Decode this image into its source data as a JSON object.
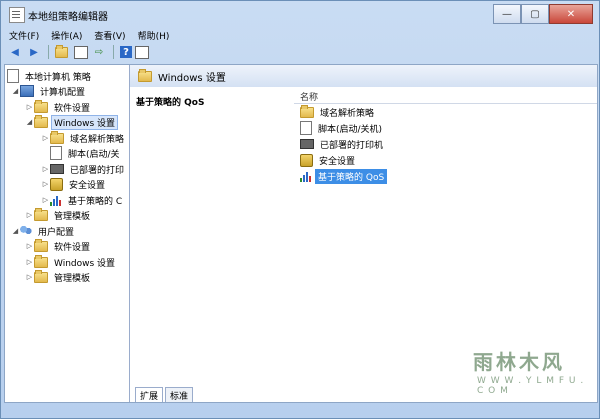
{
  "window": {
    "title": "本地组策略编辑器",
    "minimize": "—",
    "maximize": "▢",
    "close": "✕"
  },
  "menu": [
    "文件(F)",
    "操作(A)",
    "查看(V)",
    "帮助(H)"
  ],
  "tree": [
    {
      "label": "本地计算机 策略",
      "icon": "policy-icon",
      "level": 0,
      "arrow": ""
    },
    {
      "label": "计算机配置",
      "icon": "computer-icon",
      "level": 1,
      "arrow": "◢"
    },
    {
      "label": "软件设置",
      "icon": "folder-icon",
      "level": 2,
      "arrow": "▷"
    },
    {
      "label": "Windows 设置",
      "icon": "folder-icon",
      "level": 2,
      "arrow": "◢",
      "selected": true
    },
    {
      "label": "域名解析策略",
      "icon": "folder-icon",
      "level": 3,
      "arrow": "▷"
    },
    {
      "label": "脚本(启动/关",
      "icon": "script-icon",
      "level": 3,
      "arrow": ""
    },
    {
      "label": "已部署的打印",
      "icon": "printer-icon",
      "level": 3,
      "arrow": "▷"
    },
    {
      "label": "安全设置",
      "icon": "security-icon",
      "level": 3,
      "arrow": "▷"
    },
    {
      "label": "基于策略的 C",
      "icon": "qos-chart-icon",
      "level": 3,
      "arrow": "▷"
    },
    {
      "label": "管理模板",
      "icon": "folder-icon",
      "level": 2,
      "arrow": "▷"
    },
    {
      "label": "用户配置",
      "icon": "users-icon",
      "level": 1,
      "arrow": "◢"
    },
    {
      "label": "软件设置",
      "icon": "folder-icon",
      "level": 2,
      "arrow": "▷"
    },
    {
      "label": "Windows 设置",
      "icon": "folder-icon",
      "level": 2,
      "arrow": "▷"
    },
    {
      "label": "管理模板",
      "icon": "folder-icon",
      "level": 2,
      "arrow": "▷"
    }
  ],
  "pane": {
    "header": "Windows 设置",
    "selected_item_title": "基于策略的 QoS",
    "column_name": "名称",
    "items": [
      {
        "label": "域名解析策略",
        "icon": "folder-icon"
      },
      {
        "label": "脚本(启动/关机)",
        "icon": "script-icon"
      },
      {
        "label": "已部署的打印机",
        "icon": "printer-icon"
      },
      {
        "label": "安全设置",
        "icon": "security-icon"
      },
      {
        "label": "基于策略的 QoS",
        "icon": "qos-chart-icon",
        "selected": true
      }
    ],
    "tabs": [
      "扩展",
      "标准"
    ]
  },
  "watermark": {
    "text": "雨林木风",
    "url": "W W W . Y L M F U . C O M"
  },
  "colors": {
    "selection": "#3d8ee6",
    "frame": "#b7cfee"
  }
}
